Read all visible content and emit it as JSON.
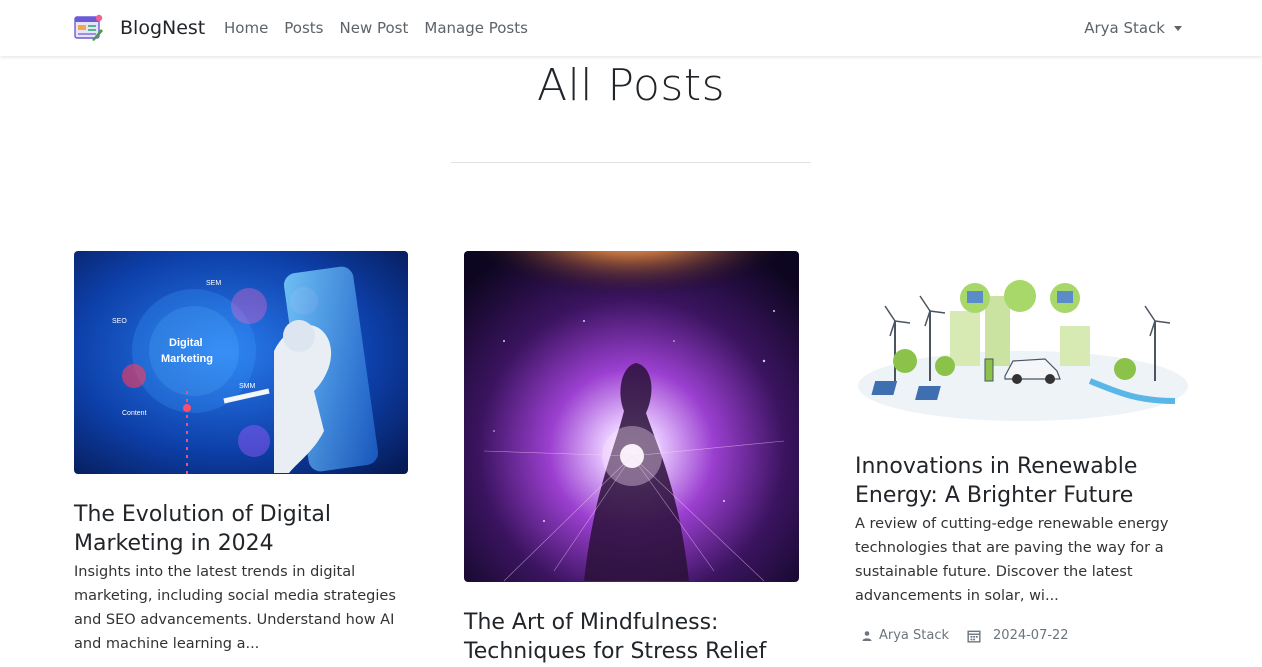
{
  "brand": {
    "name": "BlogNest",
    "logo_icon": "blog-logo-icon"
  },
  "nav": {
    "links": [
      "Home",
      "Posts",
      "New Post",
      "Manage Posts"
    ],
    "user": "Arya Stack"
  },
  "page": {
    "title": "All Posts"
  },
  "posts": [
    {
      "title": "The Evolution of Digital Marketing in 2024",
      "excerpt": "Insights into the latest trends in digital marketing, including social media strategies and SEO advancements. Understand how AI and machine learning a...",
      "image": "digital-marketing-illustration",
      "image_labels": {
        "a": "SEM",
        "b": "SEO",
        "c": "Digital",
        "d": "Marketing",
        "e": "SMM",
        "f": "Content"
      }
    },
    {
      "title": "The Art of Mindfulness: Techniques for Stress Relief",
      "image": "mindfulness-cosmic-illustration"
    },
    {
      "title": "Innovations in Renewable Energy: A Brighter Future",
      "excerpt": "A review of cutting-edge renewable energy technologies that are paving the way for a sustainable future. Discover the latest advancements in solar, wi...",
      "image": "renewable-energy-illustration",
      "author": "Arya Stack",
      "date": "2024-07-22"
    }
  ],
  "colors": {
    "nav_text": "#5c6369",
    "text": "#212529",
    "muted": "#6c757d"
  }
}
